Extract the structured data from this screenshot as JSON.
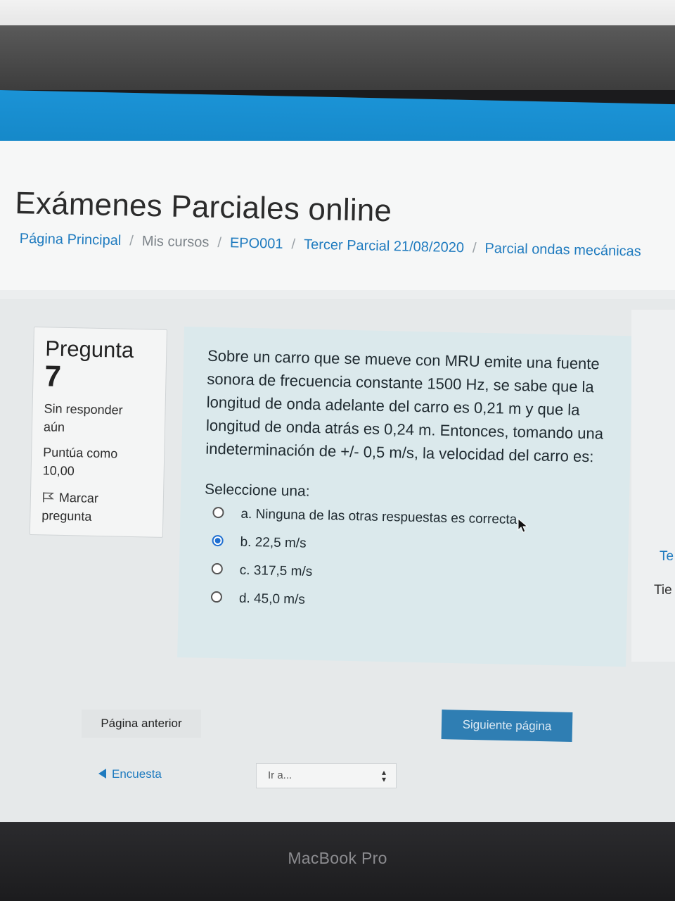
{
  "course_title": "Exámenes Parciales online",
  "breadcrumb": {
    "items": [
      "Página Principal",
      "Mis cursos",
      "EPO001",
      "Tercer Parcial 21/08/2020",
      "Parcial ondas mecánicas"
    ],
    "separator": "/"
  },
  "question_info": {
    "label": "Pregunta",
    "number": "7",
    "status_line1": "Sin responder",
    "status_line2": "aún",
    "score_line1": "Puntúa como",
    "score_line2": "10,00",
    "flag_line1": "Marcar",
    "flag_line2": "pregunta",
    "flag_icon": "flag-icon"
  },
  "question": {
    "text": "Sobre un carro que se mueve con MRU emite una fuente sonora de frecuencia constante 1500 Hz, se sabe que la longitud de onda adelante del carro es 0,21 m y que la longitud de onda atrás es 0,24 m. Entonces, tomando una indeterminación de +/- 0,5 m/s, la velocidad del carro es:",
    "select_label": "Seleccione una:",
    "answers": [
      {
        "text": "a. Ninguna de las otras respuestas es correcta.",
        "selected": false
      },
      {
        "text": "b. 22,5 m/s",
        "selected": true
      },
      {
        "text": "c. 317,5 m/s",
        "selected": false
      },
      {
        "text": "d. 45,0 m/s",
        "selected": false
      }
    ]
  },
  "navigation": {
    "prev_label": "Página anterior",
    "next_label": "Siguiente página",
    "back_link": "Encuesta",
    "jump_placeholder": "Ir a..."
  },
  "right_panel": {
    "fragment1": "Te",
    "fragment2": "Tie"
  },
  "device_label": "MacBook Pro",
  "colors": {
    "brand_blue": "#1b93d6",
    "link": "#1f7bbf",
    "question_bg": "#dbe9ec",
    "next_button": "#2f7eb3"
  }
}
